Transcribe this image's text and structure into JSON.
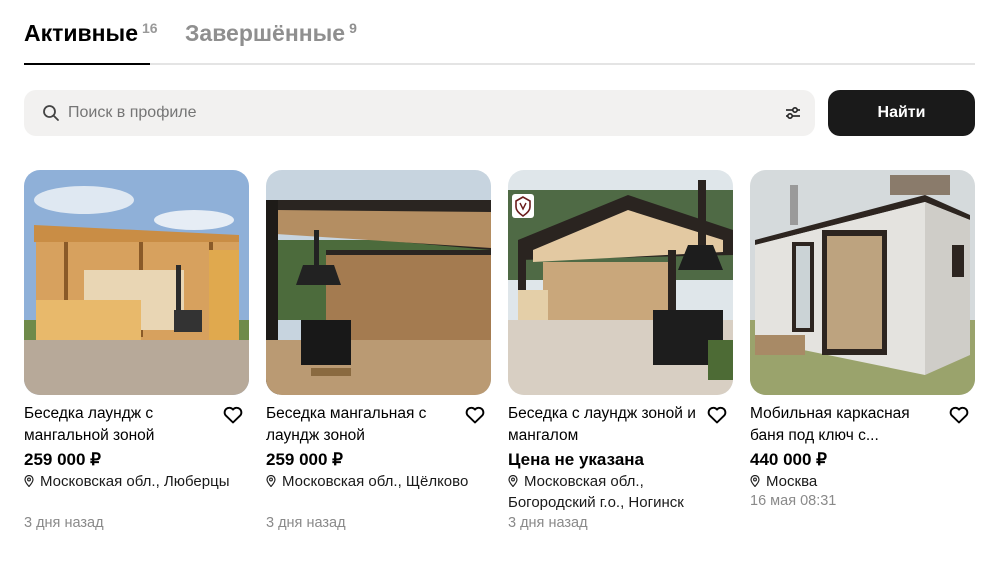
{
  "tabs": [
    {
      "label": "Активные",
      "count": "16"
    },
    {
      "label": "Завершённые",
      "count": "9"
    }
  ],
  "search": {
    "placeholder": "Поиск в профиле",
    "value": ""
  },
  "find_button": "Найти",
  "colors": {
    "accent": "#1a1a1a",
    "muted": "#8a8a8a",
    "search_bg": "#f2f1f0"
  },
  "items": [
    {
      "title": "Беседка лаундж с мангальной зоной",
      "price": "259 000 ₽",
      "location": "Московская обл., Люберцы",
      "date": "3 дня назад"
    },
    {
      "title": "Беседка мангальная с лаундж зоной",
      "price": "259 000 ₽",
      "location": "Московская обл., Щёлково",
      "date": "3 дня назад"
    },
    {
      "title": "Беседка с лаундж зоной и мангалом",
      "price": "Цена не указана",
      "location": "Московская обл., Богородский г.о., Ногинск",
      "date": "3 дня назад"
    },
    {
      "title": "Мобильная каркасная баня под ключ с...",
      "price": "440 000 ₽",
      "location": "Москва",
      "date": "16 мая 08:31"
    }
  ]
}
